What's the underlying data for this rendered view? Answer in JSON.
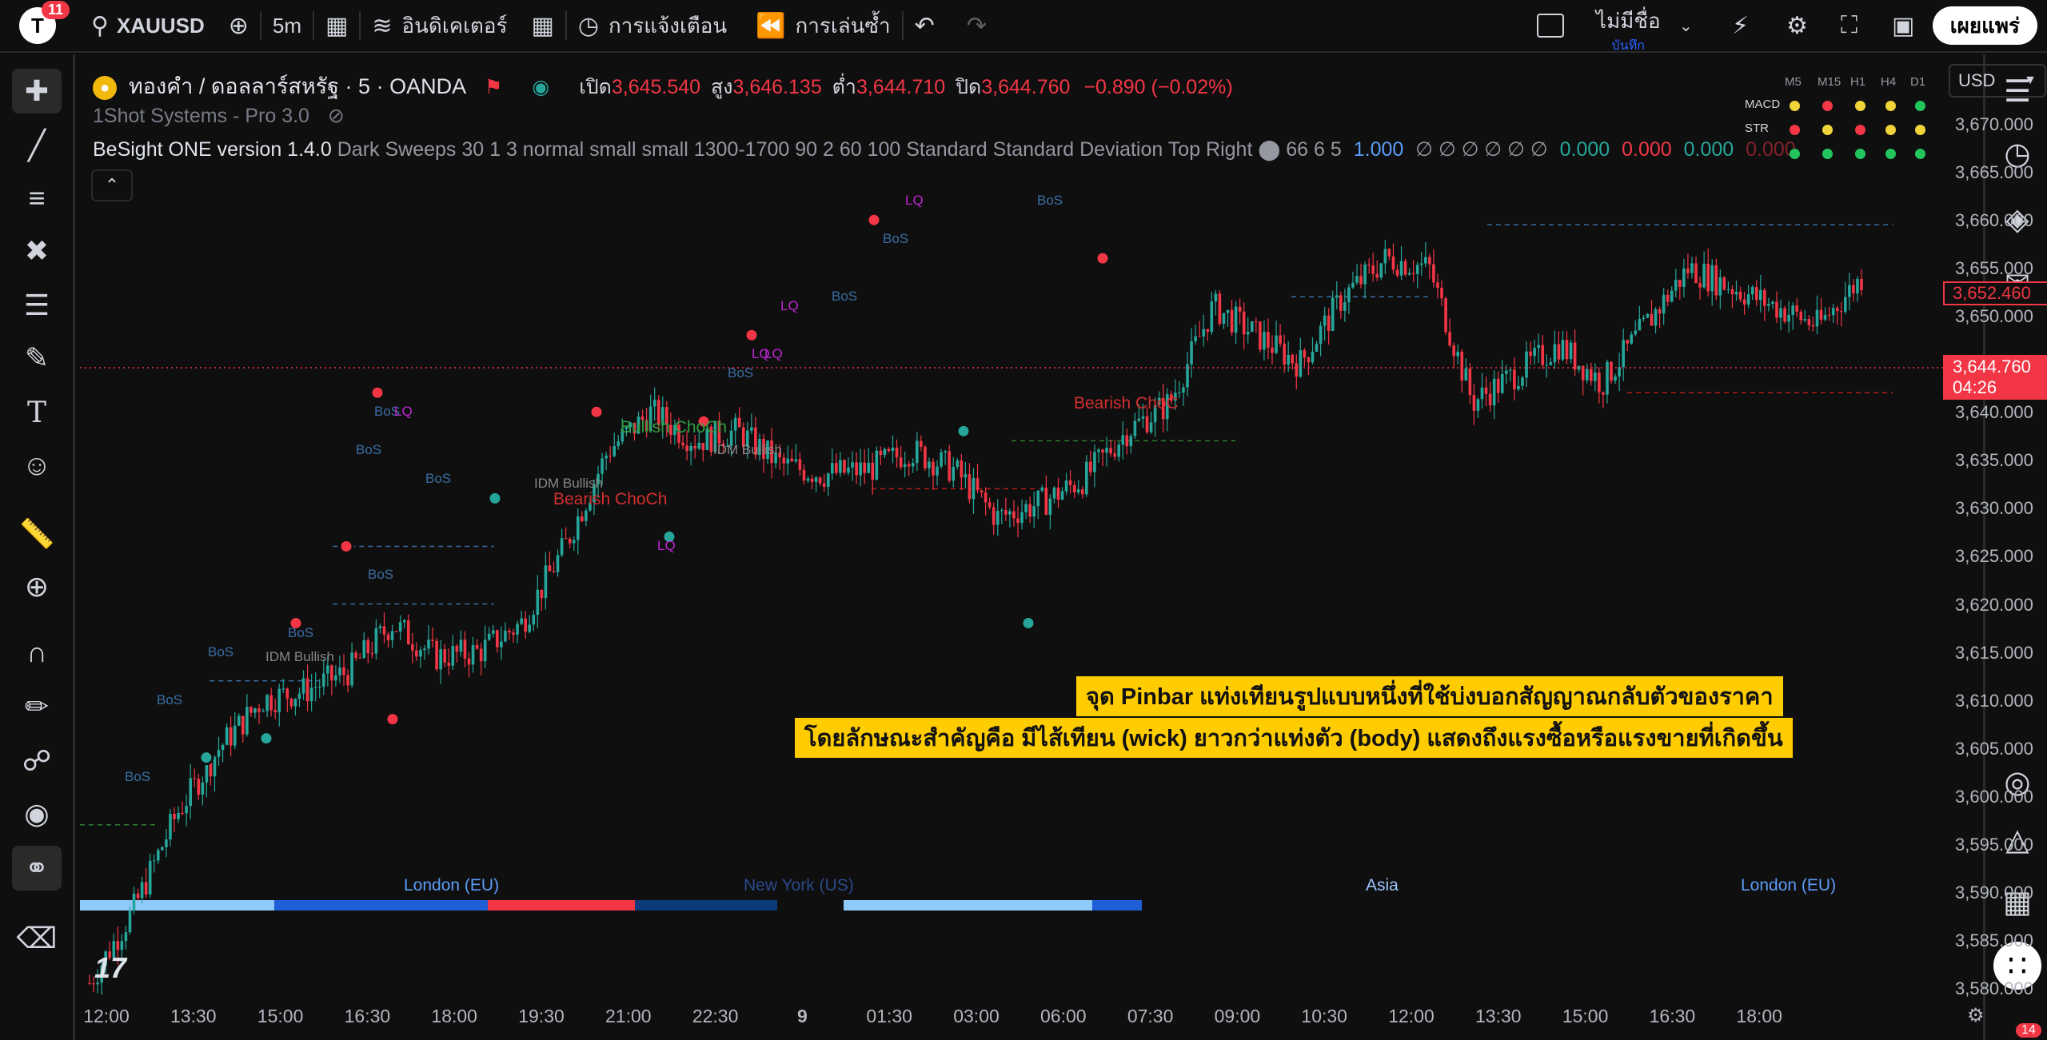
{
  "topbar": {
    "notifications": "11",
    "symbol": "XAUUSD",
    "interval": "5m",
    "indicators_label": "อินดิเคเตอร์",
    "alerts_label": "การแจ้งเตือน",
    "replay_label": "การเล่นซ้ำ",
    "layout_name": "ไม่มีชื่อ",
    "layout_status": "บันทึก",
    "publish_label": "เผยแพร่"
  },
  "legend": {
    "title": "ทองคำ / ดอลลาร์สหรัฐ · 5 · OANDA",
    "open_label": "เปิด",
    "open_value": "3,645.540",
    "high_label": "สูง",
    "high_value": "3,646.135",
    "low_label": "ต่ำ",
    "low_value": "3,644.710",
    "close_label": "ปิด",
    "close_value": "3,644.760",
    "change": "−0.890 (−0.02%)",
    "indicator1": "1Shot Systems - Pro 3.0",
    "indicator2_name": "BeSight ONE version 1.4.0",
    "indicator2_params": "Dark Sweeps 30 1 3 normal small small 1300-1700 90 2 60 100 Standard Standard Deviation Top Right ⬤ 66 6 5",
    "indicator2_v1": "1.000",
    "indicator2_sym": "∅ ∅ ∅ ∅ ∅ ∅",
    "indicator2_v2": "0.000",
    "indicator2_v3": "0.000",
    "indicator2_v4": "0.000",
    "indicator2_v5": "0.000"
  },
  "currency": "USD",
  "mtf_table": {
    "headers": [
      "M5",
      "M15",
      "H1",
      "H4",
      "D1"
    ],
    "rows": [
      {
        "label": "MACD",
        "dots": [
          "#f0d43a",
          "#f23645",
          "#f0d43a",
          "#f0d43a",
          "#22c55e"
        ]
      },
      {
        "label": "STR",
        "dots": [
          "#f23645",
          "#f0d43a",
          "#f23645",
          "#f0d43a",
          "#f0d43a"
        ]
      },
      {
        "label": "",
        "dots": [
          "#22c55e",
          "#22c55e",
          "#22c55e",
          "#22c55e",
          "#22c55e"
        ]
      }
    ]
  },
  "price_axis": [
    "3,670.000",
    "3,665.000",
    "3,660.000",
    "3,655.000",
    "3,650.000",
    "3,645.000",
    "3,640.000",
    "3,635.000",
    "3,630.000",
    "3,625.000",
    "3,620.000",
    "3,615.000",
    "3,610.000",
    "3,605.000",
    "3,600.000",
    "3,595.000",
    "3,590.000",
    "3,585.000",
    "3,580.000"
  ],
  "current_price": "3,644.760",
  "countdown": "04:26",
  "high_marker_price": "3,652.460",
  "time_axis": [
    "12:00",
    "13:30",
    "15:00",
    "16:30",
    "18:00",
    "19:30",
    "21:00",
    "22:30",
    "9",
    "01:30",
    "03:00",
    "06:00",
    "07:30",
    "09:00",
    "10:30",
    "12:00",
    "13:30",
    "15:00",
    "16:30",
    "18:00"
  ],
  "annotations": {
    "line1": "จุด Pinbar แท่งเทียนรูปแบบหนึ่งที่ใช้บ่งบอกสัญญาณกลับตัวของราคา",
    "line2": "โดยลักษณะสำคัญคือ มีไส้เทียน (wick) ยาวกว่าแท่งตัว (body) แสดงถึงแรงซื้อหรือแรงขายที่เกิดขึ้น"
  },
  "sessions": {
    "london1": "London (EU)",
    "newyork": "New York (US)",
    "asia": "Asia",
    "london2": "London (EU)"
  },
  "chart_labels": {
    "bos": "BoS",
    "lq": "LQ",
    "bullish_choch": "Bullish ChoCh",
    "bearish_choch": "Bearish ChoCh",
    "bearish_choch_right": "Bearish ChoC",
    "idm_bullish": "IDM Bullish"
  },
  "right_badge": "14",
  "chart_data": {
    "type": "candlestick",
    "symbol": "XAUUSD",
    "interval": "5m",
    "ylim": [
      3578,
      3674
    ],
    "close_path": [
      {
        "t": "12:00",
        "price": 3580.5
      },
      {
        "t": "12:45",
        "price": 3588.0
      },
      {
        "t": "13:30",
        "price": 3598.0
      },
      {
        "t": "14:15",
        "price": 3605.0
      },
      {
        "t": "15:00",
        "price": 3610.0
      },
      {
        "t": "15:45",
        "price": 3611.0
      },
      {
        "t": "16:30",
        "price": 3613.0
      },
      {
        "t": "17:15",
        "price": 3618.0
      },
      {
        "t": "18:00",
        "price": 3614.5
      },
      {
        "t": "18:45",
        "price": 3615.0
      },
      {
        "t": "19:30",
        "price": 3618.0
      },
      {
        "t": "20:15",
        "price": 3626.0
      },
      {
        "t": "21:00",
        "price": 3636.0
      },
      {
        "t": "21:45",
        "price": 3640.0
      },
      {
        "t": "22:30",
        "price": 3637.0
      },
      {
        "t": "23:15",
        "price": 3638.0
      },
      {
        "t": "00:30",
        "price": 3634.5
      },
      {
        "t": "01:30",
        "price": 3633.5
      },
      {
        "t": "02:15",
        "price": 3634.0
      },
      {
        "t": "03:00",
        "price": 3636.0
      },
      {
        "t": "04:30",
        "price": 3634.0
      },
      {
        "t": "05:30",
        "price": 3629.0
      },
      {
        "t": "06:00",
        "price": 3630.5
      },
      {
        "t": "06:45",
        "price": 3633.0
      },
      {
        "t": "07:30",
        "price": 3638.0
      },
      {
        "t": "08:15",
        "price": 3641.0
      },
      {
        "t": "09:00",
        "price": 3651.0
      },
      {
        "t": "09:45",
        "price": 3648.0
      },
      {
        "t": "10:30",
        "price": 3645.0
      },
      {
        "t": "11:15",
        "price": 3652.0
      },
      {
        "t": "12:00",
        "price": 3656.0
      },
      {
        "t": "12:45",
        "price": 3655.0
      },
      {
        "t": "13:15",
        "price": 3641.0
      },
      {
        "t": "13:30",
        "price": 3644.0
      },
      {
        "t": "14:15",
        "price": 3647.0
      },
      {
        "t": "15:00",
        "price": 3643.0
      },
      {
        "t": "15:45",
        "price": 3649.0
      },
      {
        "t": "16:30",
        "price": 3655.0
      },
      {
        "t": "17:15",
        "price": 3653.0
      },
      {
        "t": "18:00",
        "price": 3651.0
      },
      {
        "t": "18:45",
        "price": 3649.0
      },
      {
        "t": "19:15",
        "price": 3654.0
      }
    ]
  }
}
